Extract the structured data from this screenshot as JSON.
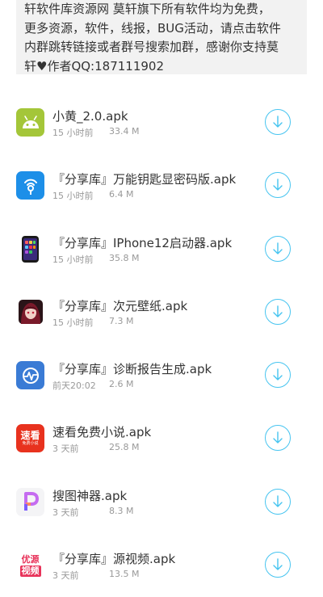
{
  "notice": {
    "lines": [
      "轩软件库资源网 莫轩旗下所有软件均为免费，",
      "更多资源，软件，线报，BUG活动，请点击软件",
      "内群跳转链接或者群号搜索加群，感谢你支持莫",
      "轩♥作者QQ:187111902"
    ]
  },
  "colors": {
    "accent": "#46c4f0",
    "meta_text": "#999999",
    "notice_bg": "#f2f2f2"
  },
  "items": [
    {
      "name": "小黄_2.0.apk",
      "time": "15 小时前",
      "size": "33.4 M",
      "icon": "android-icon"
    },
    {
      "name": "『分享库』万能钥匙显密码版.apk",
      "time": "15 小时前",
      "size": "6.4 M",
      "icon": "wifi-key-icon"
    },
    {
      "name": "『分享库』IPhone12启动器.apk",
      "time": "15 小时前",
      "size": "35.8 M",
      "icon": "iphone-launcher-icon"
    },
    {
      "name": "『分享库』次元壁纸.apk",
      "time": "15 小时前",
      "size": "7.3 M",
      "icon": "anime-wallpaper-icon"
    },
    {
      "name": "『分享库』诊断报告生成.apk",
      "time": "前天20:02",
      "size": "2.6 M",
      "icon": "diagnosis-report-icon"
    },
    {
      "name": "速看免费小说.apk",
      "time": "3 天前",
      "size": "25.8 M",
      "icon": "sukan-novel-icon",
      "icon_text": "速看",
      "icon_subtext": "免费小说"
    },
    {
      "name": "搜图神器.apk",
      "time": "3 天前",
      "size": "8.3 M",
      "icon": "picture-search-icon"
    },
    {
      "name": "『分享库』源视频.apk",
      "time": "3 天前",
      "size": "13.5 M",
      "icon": "youyuan-video-icon",
      "icon_text1": "优源",
      "icon_text2": "视频"
    }
  ]
}
